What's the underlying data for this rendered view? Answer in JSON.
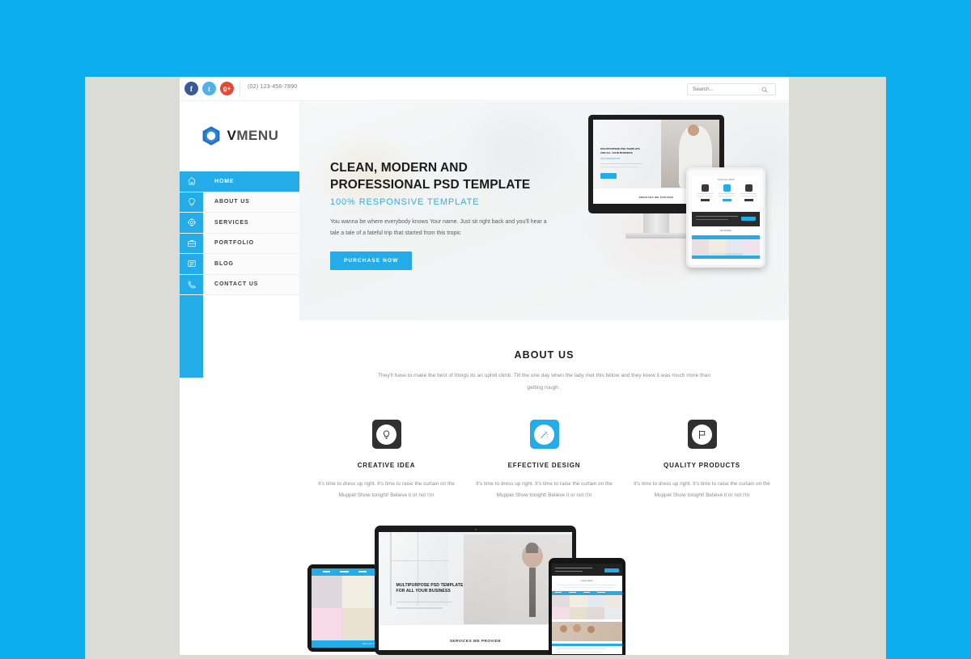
{
  "theme": {
    "page_background": "#0cadee",
    "panel_background": "#dcdcd7",
    "accent": "#23ace8",
    "dark": "#303030"
  },
  "topbar": {
    "social": [
      {
        "name": "facebook",
        "glyph": "f",
        "color": "#3b5998"
      },
      {
        "name": "twitter",
        "glyph": "t",
        "color": "#4db2ec"
      },
      {
        "name": "google-plus",
        "glyph": "g+",
        "color": "#e04b35"
      }
    ],
    "phone": "(02) 123-456-7890",
    "search_placeholder": "Search...",
    "search_value": ""
  },
  "logo": {
    "primary": "V",
    "secondary": "MENU"
  },
  "nav": {
    "items": [
      {
        "label": "HOME",
        "icon": "home-icon",
        "active": true
      },
      {
        "label": "ABOUT US",
        "icon": "lightbulb-icon",
        "active": false
      },
      {
        "label": "SERVICES",
        "icon": "gear-icon",
        "active": false
      },
      {
        "label": "PORTFOLIO",
        "icon": "briefcase-icon",
        "active": false
      },
      {
        "label": "BLOG",
        "icon": "book-icon",
        "active": false
      },
      {
        "label": "CONTACT US",
        "icon": "phone-icon",
        "active": false
      }
    ]
  },
  "hero": {
    "title_line1": "CLEAN, MODERN AND",
    "title_line2": "PROFESSIONAL PSD TEMPLATE",
    "subtitle": "100% RESPONSIVE TEMPLATE",
    "paragraph": "You wanna be where everybody knows Your name. Just sit right back and you'll hear a tale a tale of a fateful trip that started from this tropic",
    "cta_label": "PURCHASE NOW",
    "mockup": {
      "headline_line1": "MULTIPURPOSE PSD TEMPLATE",
      "headline_line2": "FOR ALL YOUR BUSINESS",
      "section_label": "SERVICES WE PROVIDE",
      "button_label": "Read More"
    }
  },
  "about": {
    "title": "ABOUT US",
    "description": "They'll have to make the best of things its an uphill climb. Till the one day when the lady met this fellow and they knew it was much more than getting rough .",
    "features": [
      {
        "name": "CREATIVE IDEA",
        "icon": "lightbulb-icon",
        "accent": false,
        "text": "It's time to dress up right. It's time to raise the curtain on the Muppet Show tonight! Believe it or not I'm"
      },
      {
        "name": "EFFECTIVE DESIGN",
        "icon": "magic-wand-icon",
        "accent": true,
        "text": "It's time to dress up right. It's time to raise the curtain on the Muppet Show tonight! Believe it or not I'm"
      },
      {
        "name": "QUALITY PRODUCTS",
        "icon": "flag-icon",
        "accent": false,
        "text": "It's time to dress up right. It's time to raise the curtain on the Muppet Show tonight! Believe it or not I'm"
      }
    ]
  },
  "showcase": {
    "headline_line1": "MULTIPURPOSE PSD TEMPLATE",
    "headline_line2": "FOR ALL YOUR BUSINESS",
    "section_label": "SERVICES WE PROVIDE",
    "laptop_cta": "View Our Portfolio"
  }
}
